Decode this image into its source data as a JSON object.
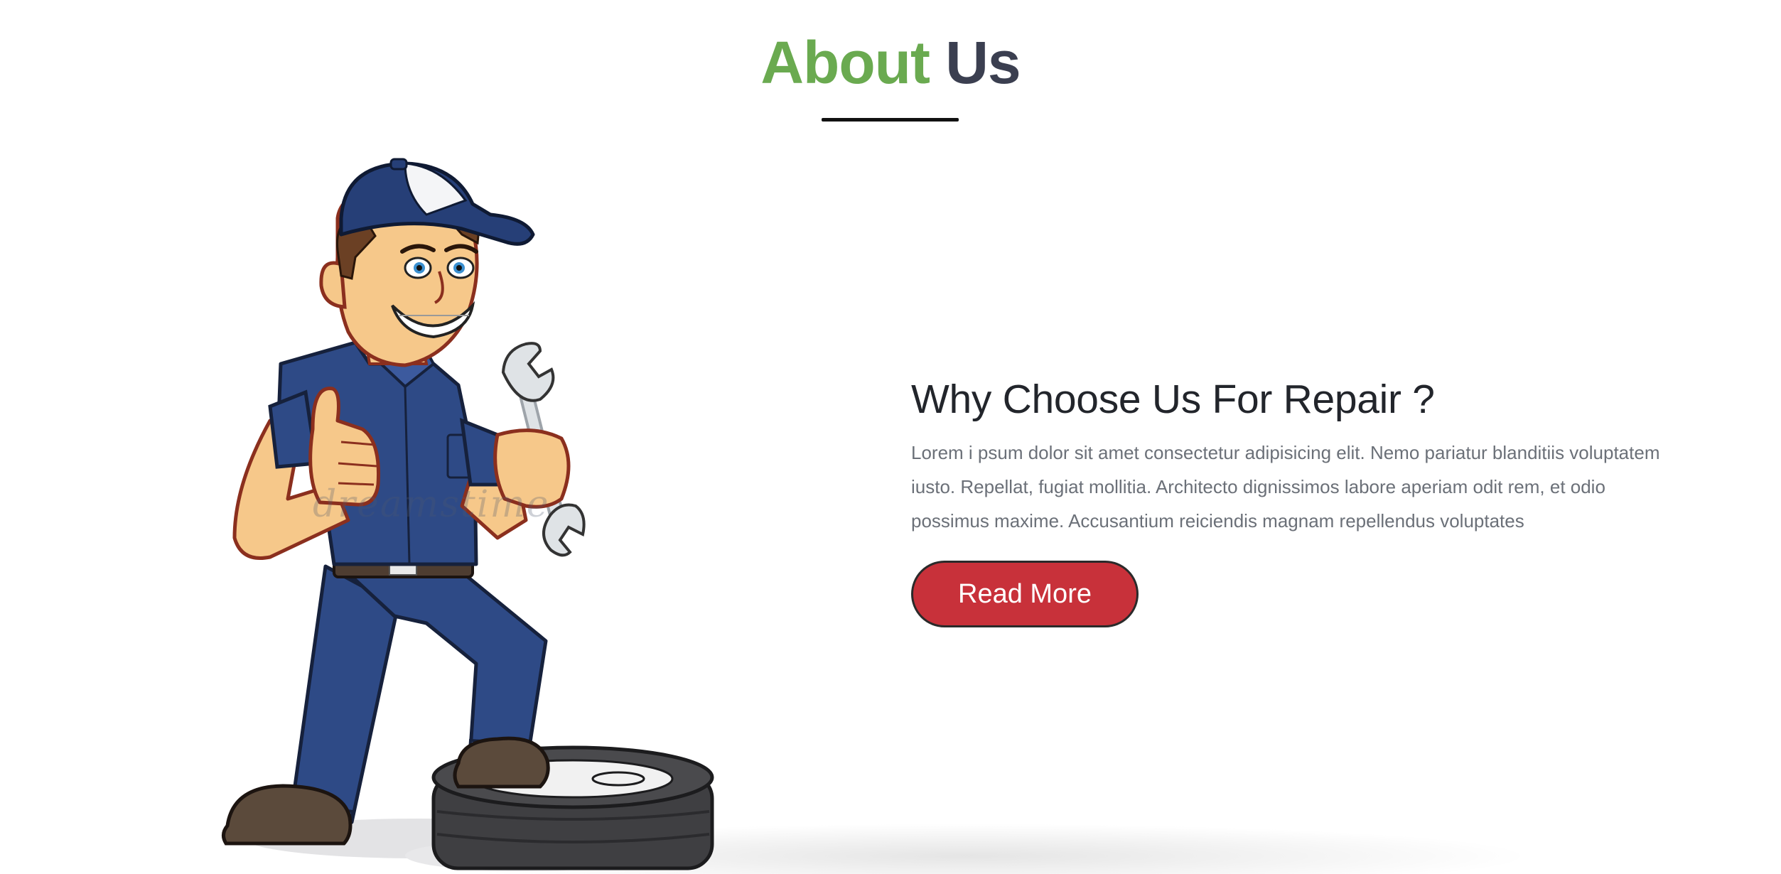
{
  "about": {
    "title_accent": "About",
    "title_rest": "Us"
  },
  "mascot": {
    "icon": "mechanic-illustration",
    "watermark": "dreamstime"
  },
  "content": {
    "heading": "Why Choose Us For Repair ?",
    "paragraph": "Lorem i psum dolor sit amet consectetur adipisicing elit. Nemo pariatur blanditiis voluptatem iusto. Repellat, fugiat mollitia. Architecto dignissimos labore aperiam odit rem, et odio possimus maxime. Accusantium reiciendis magnam repellendus voluptates",
    "button_label": "Read More"
  },
  "colors": {
    "accent_green": "#6aaa50",
    "heading_dark": "#3b3f50",
    "button_red": "#c8313a",
    "body_text": "#6b7078"
  }
}
